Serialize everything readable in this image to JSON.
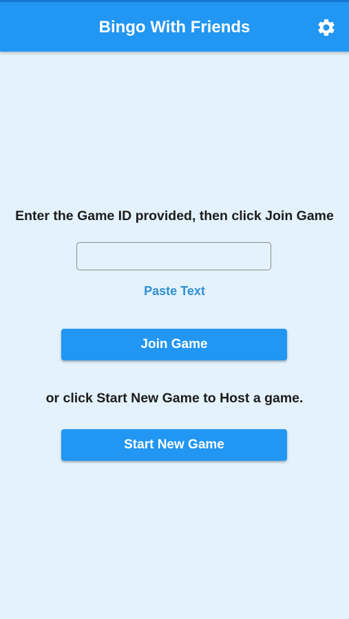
{
  "app_bar": {
    "title": "Bingo With Friends",
    "settings_icon": "gear-icon",
    "color": "#2196f3"
  },
  "join": {
    "prompt": "Enter the Game ID provided, then click Join Game",
    "game_id_value": "",
    "paste_label": "Paste Text",
    "join_button_label": "Join Game"
  },
  "host": {
    "prompt": "or click Start New Game to Host a game.",
    "start_button_label": "Start New Game"
  },
  "colors": {
    "background": "#e3f2fd",
    "accent": "#2196f3",
    "link": "#2f8fd4"
  }
}
